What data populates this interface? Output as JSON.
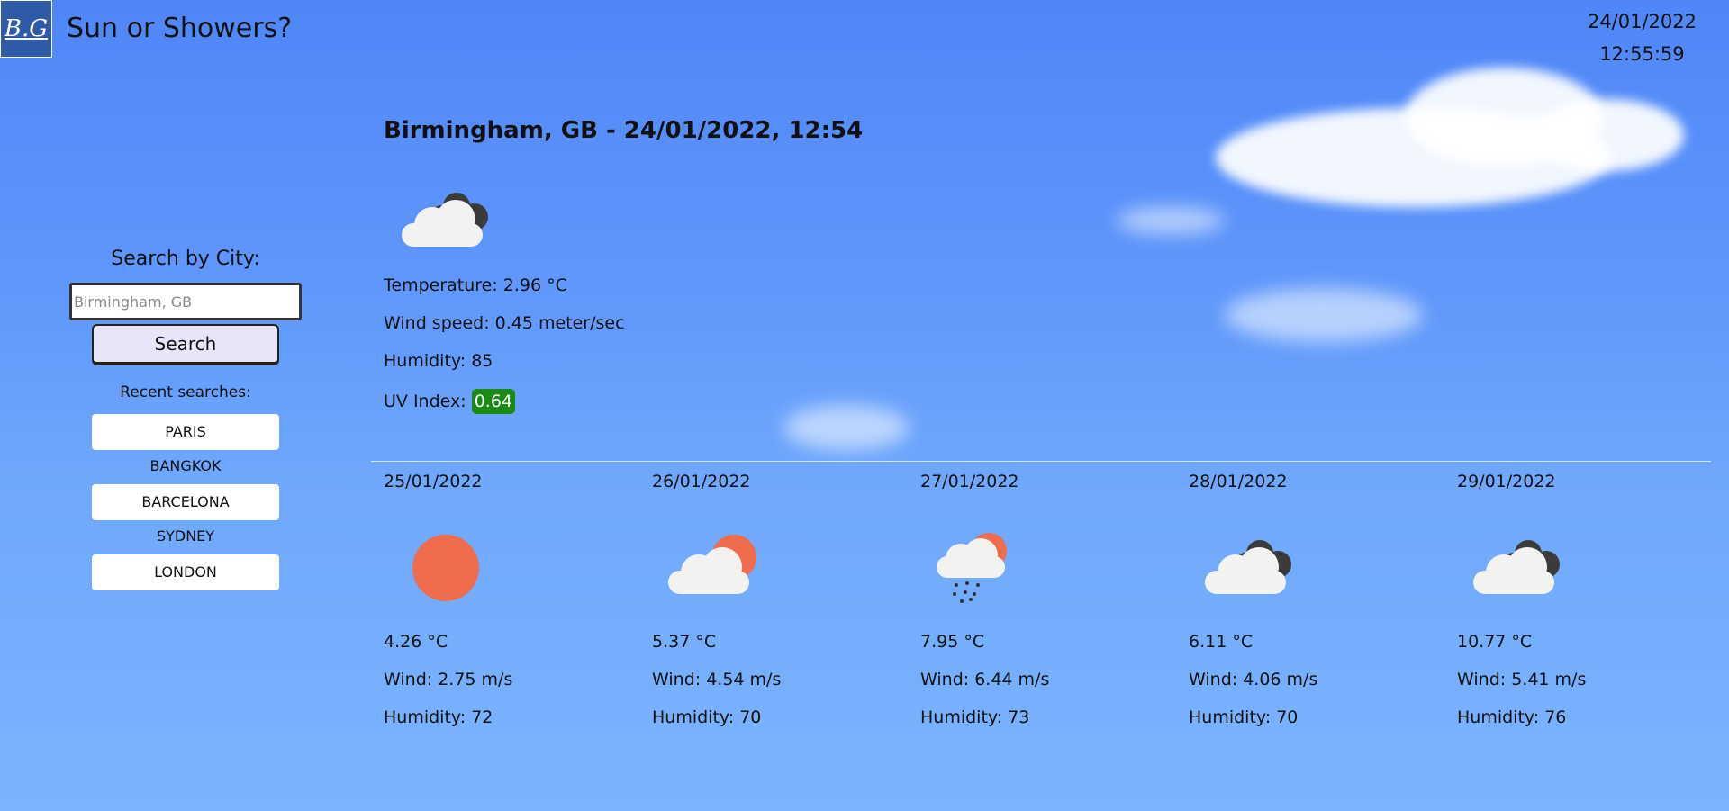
{
  "header": {
    "logo_text": "B.G",
    "title": "Sun or Showers?",
    "date": "24/01/2022",
    "time": "12:55:59"
  },
  "sidebar": {
    "search_label": "Search by City:",
    "search_placeholder": "Birmingham, GB",
    "search_button": "Search",
    "recent_label": "Recent searches:",
    "recent": [
      {
        "label": "PARIS"
      },
      {
        "label": "BANGKOK"
      },
      {
        "label": "BARCELONA"
      },
      {
        "label": "SYDNEY"
      },
      {
        "label": "LONDON"
      }
    ]
  },
  "current": {
    "title": "Birmingham, GB - 24/01/2022, 12:54",
    "icon": "broken-clouds-icon",
    "temperature": "Temperature: 2.96 °C",
    "wind": "Wind speed: 0.45 meter/sec",
    "humidity": "Humidity: 85",
    "uv_label": "UV Index:",
    "uv_value": "0.64",
    "uv_color": "#1a8a14"
  },
  "forecast": [
    {
      "date": "25/01/2022",
      "icon": "clear-sun-icon",
      "temp": "4.26 °C",
      "wind": "Wind: 2.75 m/s",
      "humidity": "Humidity: 72"
    },
    {
      "date": "26/01/2022",
      "icon": "few-clouds-icon",
      "temp": "5.37 °C",
      "wind": "Wind: 4.54 m/s",
      "humidity": "Humidity: 70"
    },
    {
      "date": "27/01/2022",
      "icon": "rain-sun-icon",
      "temp": "7.95 °C",
      "wind": "Wind: 6.44 m/s",
      "humidity": "Humidity: 73"
    },
    {
      "date": "28/01/2022",
      "icon": "broken-clouds-icon",
      "temp": "6.11 °C",
      "wind": "Wind: 4.06 m/s",
      "humidity": "Humidity: 70"
    },
    {
      "date": "29/01/2022",
      "icon": "broken-clouds-icon",
      "temp": "10.77 °C",
      "wind": "Wind: 5.41 m/s",
      "humidity": "Humidity: 76"
    }
  ],
  "colors": {
    "sun": "#ef6c4c",
    "cloud_light": "#f2f2f0",
    "cloud_dark": "#3b3b3b"
  }
}
